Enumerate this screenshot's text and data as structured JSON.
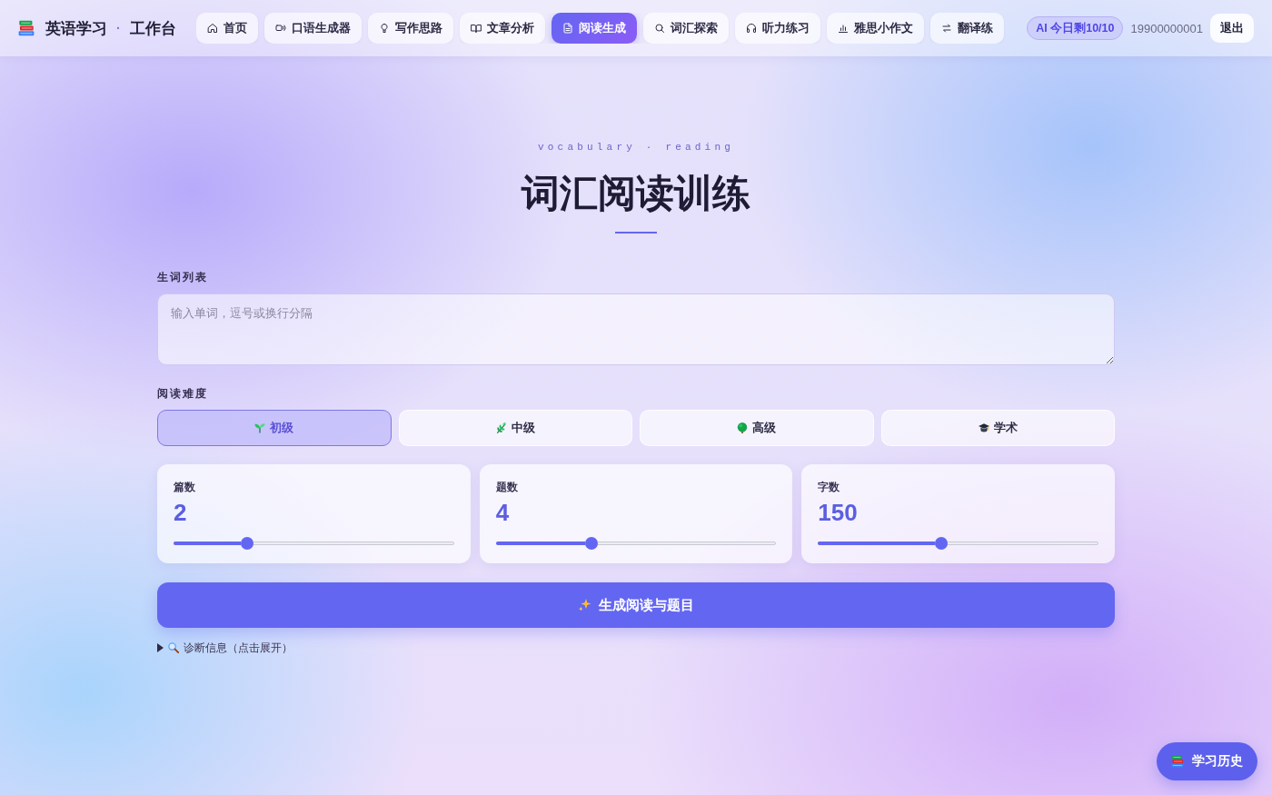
{
  "header": {
    "title": "英语学习",
    "separator": "·",
    "subtitle": "工作台"
  },
  "nav": {
    "items": [
      {
        "label": "首页",
        "selected": false
      },
      {
        "label": "口语生成器",
        "selected": false
      },
      {
        "label": "写作思路",
        "selected": false
      },
      {
        "label": "文章分析",
        "selected": false
      },
      {
        "label": "阅读生成",
        "selected": true
      },
      {
        "label": "词汇探索",
        "selected": false
      },
      {
        "label": "听力练习",
        "selected": false
      },
      {
        "label": "雅思小作文",
        "selected": false
      },
      {
        "label": "翻译练",
        "selected": false
      }
    ]
  },
  "account": {
    "quota_badge": "AI 今日剩10/10",
    "phone": "19900000001",
    "logout_button": "退出"
  },
  "page": {
    "eyebrow": "vocabulary · reading",
    "title": "词汇阅读训练"
  },
  "word_list": {
    "label": "生词列表",
    "placeholder": "输入单词，逗号或换行分隔"
  },
  "difficulty": {
    "label": "阅读难度",
    "options": [
      {
        "label": "初级",
        "selected": true
      },
      {
        "label": "中级",
        "selected": false
      },
      {
        "label": "高级",
        "selected": false
      },
      {
        "label": "学术",
        "selected": false
      }
    ]
  },
  "sliders": [
    {
      "label": "篇数",
      "value": "2",
      "level": 0.26
    },
    {
      "label": "题数",
      "value": "4",
      "level": 0.34
    },
    {
      "label": "字数",
      "value": "150",
      "level": 0.44
    }
  ],
  "generate_button": {
    "label": "生成阅读与题目"
  },
  "diagnostics": {
    "label": "诊断信息（点击展开）",
    "expanded": false
  },
  "history_button": {
    "label": "学习历史"
  }
}
